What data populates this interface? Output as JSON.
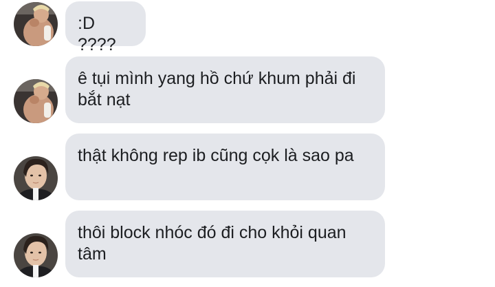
{
  "messages": [
    {
      "sender": "avatar-a",
      "text": ":D ????"
    },
    {
      "sender": "avatar-a",
      "text": "ê tụi mình yang hồ chứ khum phải đi bắt nạt"
    },
    {
      "sender": "avatar-b",
      "text": "thật không rep ib cũng cọk là sao pa"
    },
    {
      "sender": "avatar-b",
      "text": "thôi block nhóc đó đi cho khỏi quan tâm"
    }
  ],
  "colors": {
    "bubble_bg": "#e4e6eb",
    "text": "#1c1e21",
    "background": "#ffffff"
  }
}
